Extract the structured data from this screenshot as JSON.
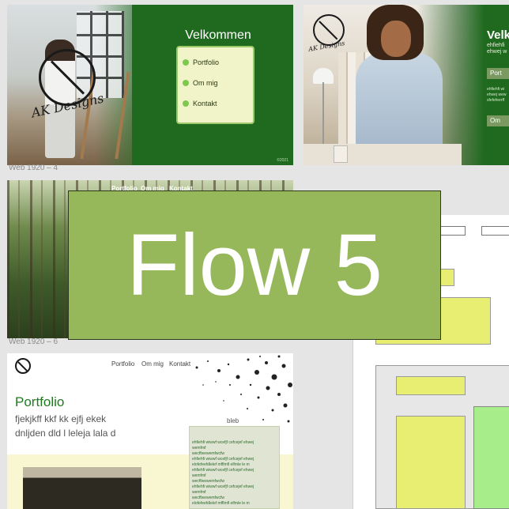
{
  "frame1": {
    "title": "Velkommen",
    "menu": [
      "Portfolio",
      "Om mig",
      "Kontakt"
    ],
    "copyright": "©2021",
    "logo_text": "AK Designs",
    "colors": {
      "bg": "#1f6a1f",
      "menu_bg": "#f1f3c9",
      "dot": "#7ec84f"
    }
  },
  "frame2": {
    "heading": "Velk",
    "sub_lines": [
      "ehfiehfi",
      "ehwej w"
    ],
    "buttons": [
      "Port",
      "Om"
    ],
    "small_lines": [
      "ehfiehfi wi",
      "ehwej wew",
      "sfefefeerff"
    ],
    "logo_text": "AK Designs"
  },
  "caption_web4": "Web 1920 – 4",
  "frame3": {
    "nav": [
      "Portfolio",
      "Om mig",
      "Kontakt"
    ]
  },
  "caption_web6": "Web 1920 – 6",
  "frame4": {
    "nav": [
      "Portfolio",
      "Om mig",
      "Kontakt"
    ],
    "title": "Portfolio",
    "lines": [
      "fjekjkff kkf kk ejfj ekek",
      "dnljden dld l leleja lala d"
    ],
    "sidebar_title": "bleb",
    "sidebar_lines": [
      "ehfiehfi wiwwf wcefjf cefcejef ehwej",
      "wemfmf",
      "wecffwewemfwcfw",
      "ehfiehfi wiwwf wcefjf cefcejef ehwej",
      "elofefeefdlelef mfflmfl elfmle le m",
      "ehfiehfi wiwwf wcefjf cefcejef ehwej",
      "wemfmf",
      "wecffwewemfwcfw",
      "ehfiehfi wiwwf wcefjf cefcejef ehwej",
      "wemfmf",
      "wecffwewemfwcfw",
      "elofefeefdlelef mfflmfl elfmle le m"
    ]
  },
  "overlay": {
    "text": "Flow 5",
    "color": "#96b75a"
  }
}
